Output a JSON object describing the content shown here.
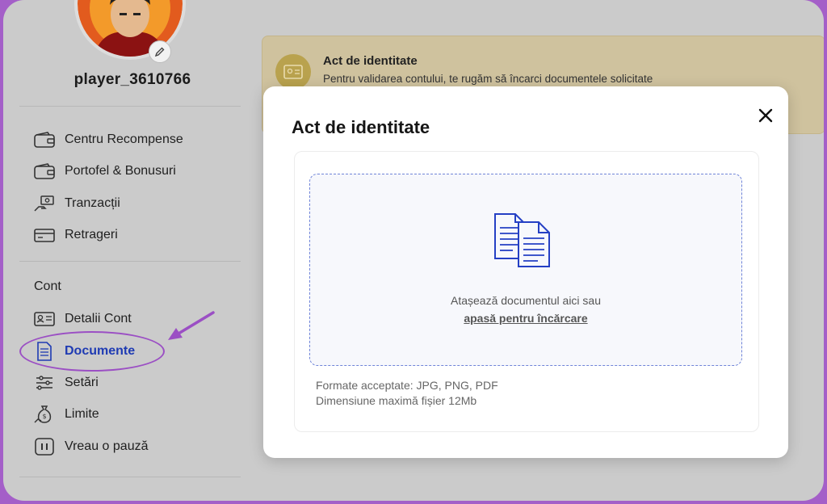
{
  "profile": {
    "username": "player_3610766"
  },
  "sidebar": {
    "items": [
      {
        "label": "Centru Recompense",
        "icon": "wallet-icon"
      },
      {
        "label": "Portofel & Bonusuri",
        "icon": "wallet-icon"
      },
      {
        "label": "Tranzacții",
        "icon": "money-hand-icon"
      },
      {
        "label": "Retrageri",
        "icon": "card-icon"
      }
    ],
    "section_label": "Cont",
    "account_items": [
      {
        "label": "Detalii Cont",
        "icon": "id-card-icon"
      },
      {
        "label": "Documente",
        "icon": "document-icon",
        "active": true
      },
      {
        "label": "Setări",
        "icon": "sliders-icon"
      },
      {
        "label": "Limite",
        "icon": "money-bag-icon"
      },
      {
        "label": "Vreau o pauză",
        "icon": "pause-icon"
      }
    ]
  },
  "banner": {
    "title": "Act de identitate",
    "text": "Pentru validarea contului, te rugăm să încarci documentele solicitate"
  },
  "modal": {
    "title": "Act de identitate",
    "drop_text": "Atașează documentul aici sau",
    "drop_link": "apasă pentru încărcare",
    "formats": "Formate acceptate: JPG, PNG, PDF",
    "max_size": "Dimensiune maximă fișier 12Mb"
  },
  "colors": {
    "accent": "#1f3bb3",
    "highlight": "#9b4fc4",
    "banner": "#cfc29e"
  }
}
